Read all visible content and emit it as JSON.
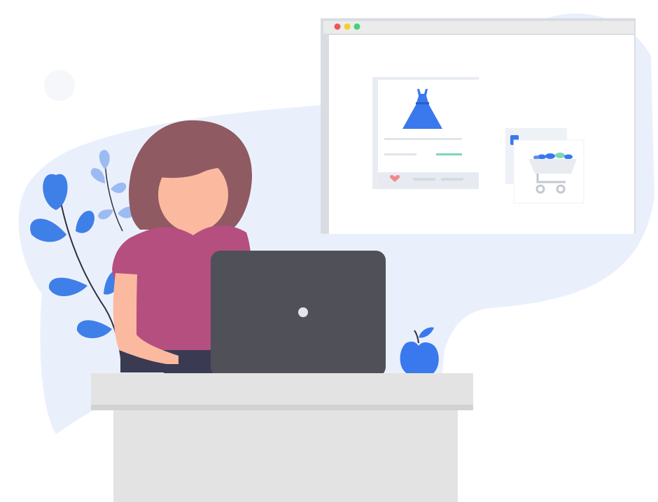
{
  "colors": {
    "background": "#ffffff",
    "blob": "#eaf0fb",
    "window_frame": "#d9dde3",
    "window_titlebar": "#ebebeb",
    "traffic_red": "#f0545a",
    "traffic_yellow": "#f2d02a",
    "traffic_green": "#45d07c",
    "accent_blue": "#3a78ee",
    "leaf_blue": "#3f7fe8",
    "leaf_light_blue": "#9cbbf2",
    "hair": "#8f5a62",
    "skin": "#fbb9a0",
    "shirt": "#b54f80",
    "laptop": "#4f5058",
    "desk": "#e3e3e3",
    "price_line": "#7ed7b4",
    "heart": "#f08a8a"
  },
  "icons": {
    "window": "browser-window",
    "product": "dress-icon",
    "cart": "shopping-cart-icon",
    "favorite": "heart-icon",
    "decorative": "apple-icon"
  }
}
